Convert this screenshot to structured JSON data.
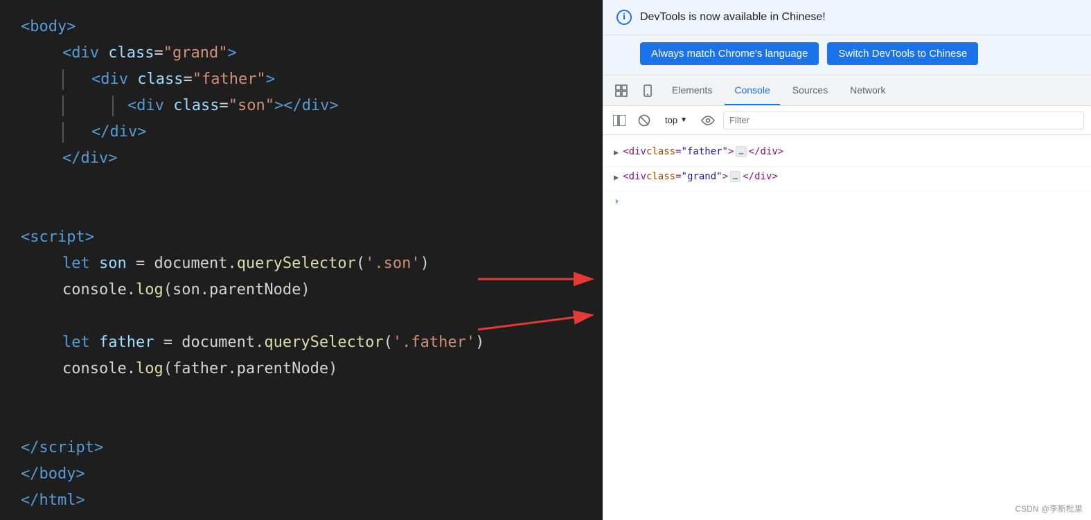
{
  "code_panel": {
    "lines": [
      {
        "indent": 0,
        "content": "&lt;body&gt;",
        "type": "tag_line"
      },
      {
        "indent": 1,
        "content": "&lt;div class=\"grand\"&gt;",
        "type": "tag_line"
      },
      {
        "indent": 2,
        "bar": true,
        "content": "&lt;div class=\"father\"&gt;",
        "type": "tag_line"
      },
      {
        "indent": 3,
        "bar2": true,
        "content": "&lt;div class=\"son\"&gt;&lt;/div&gt;",
        "type": "tag_line"
      },
      {
        "indent": 2,
        "bar": true,
        "content": "&lt;/div&gt;",
        "type": "tag_line"
      },
      {
        "indent": 1,
        "content": "&lt;/div&gt;",
        "type": "tag_line"
      },
      {
        "indent": 0,
        "content": "",
        "type": "blank"
      },
      {
        "indent": 0,
        "content": "",
        "type": "blank"
      },
      {
        "indent": 0,
        "content": "&lt;script&gt;",
        "type": "tag_line"
      },
      {
        "indent": 1,
        "content": "let son = document.querySelector('.son')",
        "type": "code"
      },
      {
        "indent": 1,
        "content": "console.log(son.parentNode)",
        "type": "code"
      },
      {
        "indent": 0,
        "content": "",
        "type": "blank"
      },
      {
        "indent": 1,
        "content": "let father = document.querySelector('.father')",
        "type": "code"
      },
      {
        "indent": 1,
        "content": "console.log(father.parentNode)",
        "type": "code"
      },
      {
        "indent": 0,
        "content": "",
        "type": "blank"
      },
      {
        "indent": 0,
        "content": "",
        "type": "blank"
      },
      {
        "indent": 0,
        "content": "&lt;/script&gt;",
        "type": "tag_line"
      },
      {
        "indent": 0,
        "content": "&lt;/body&gt;",
        "type": "tag_line"
      },
      {
        "indent": 0,
        "content": "&lt;/html&gt;",
        "type": "tag_line"
      }
    ]
  },
  "devtools": {
    "notification": {
      "text": "DevTools is now available in Chinese!",
      "btn1": "Always match Chrome's language",
      "btn2": "Switch DevTools to Chinese"
    },
    "tabs": {
      "items": [
        "Elements",
        "Console",
        "Sources",
        "Network"
      ],
      "active": "Console",
      "icons": [
        "grid-icon",
        "mobile-icon"
      ]
    },
    "toolbar": {
      "top_label": "top",
      "filter_placeholder": "Filter"
    },
    "console_entries": [
      {
        "expand": "▶",
        "html": "&lt;div class=\"father\"&gt;",
        "ellipsis": "…",
        "close": "&lt;/div&gt;"
      },
      {
        "expand": "▶",
        "html": "&lt;div class=\"grand\"&gt;",
        "ellipsis": "…",
        "close": "&lt;/div&gt;"
      }
    ],
    "prompt": "›"
  },
  "watermark": "CSDN @李斯枇果"
}
